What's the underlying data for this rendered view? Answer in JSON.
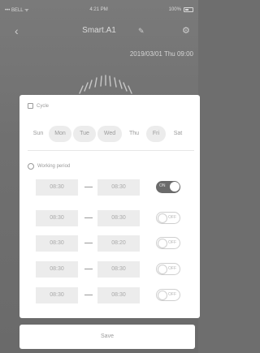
{
  "status_bar": {
    "carrier": "••• BELL ᯤ",
    "time": "4:21 PM",
    "battery": "100%"
  },
  "nav": {
    "title": "Smart.A1"
  },
  "date_line": "2019/03/01 Thu  09:00",
  "cycle": {
    "title": "Cycle",
    "days": [
      {
        "label": "Sun",
        "selected": false
      },
      {
        "label": "Mon",
        "selected": true
      },
      {
        "label": "Tue",
        "selected": true
      },
      {
        "label": "Wed",
        "selected": true
      },
      {
        "label": "Thu",
        "selected": false
      },
      {
        "label": "Fri",
        "selected": true
      },
      {
        "label": "Sat",
        "selected": false
      }
    ]
  },
  "working_period": {
    "title": "Working period",
    "rows": [
      {
        "start": "08:30",
        "end": "08:30",
        "toggle": "ON",
        "on": true
      },
      {
        "start": "08:30",
        "end": "08:30",
        "toggle": "OFF",
        "on": false
      },
      {
        "start": "08:30",
        "end": "08:20",
        "toggle": "OFF",
        "on": false
      },
      {
        "start": "08:30",
        "end": "08:30",
        "toggle": "OFF",
        "on": false
      },
      {
        "start": "08:30",
        "end": "08:30",
        "toggle": "OFF",
        "on": false
      }
    ]
  },
  "save_label": "Save",
  "colors": {
    "overlay": "#707070",
    "toggle_on": "#6b6b6b",
    "chip": "#ececec"
  }
}
